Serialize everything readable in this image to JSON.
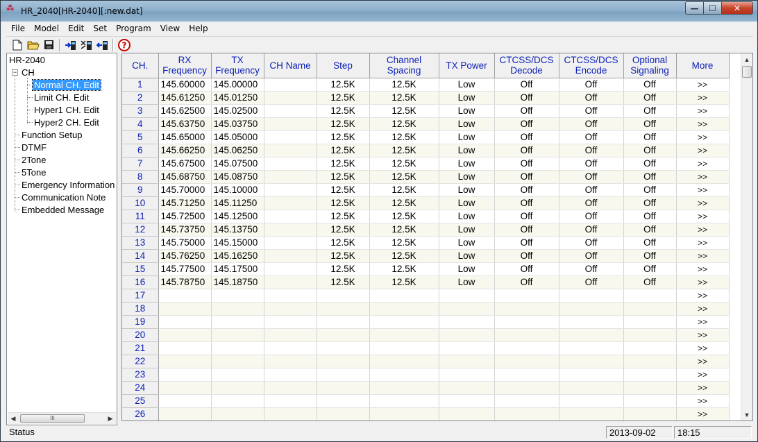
{
  "window": {
    "title": "HR_2040[HR-2040][:new.dat]",
    "controls": {
      "minimize": "—",
      "maximize": "☐",
      "close": "✕"
    }
  },
  "menu": [
    "File",
    "Model",
    "Edit",
    "Set",
    "Program",
    "View",
    "Help"
  ],
  "toolbar": {
    "buttons": [
      "new-file-icon",
      "open-folder-icon",
      "save-icon",
      "read-radio-icon",
      "write-radio-icon",
      "clone-radio-icon",
      "help-icon"
    ]
  },
  "tree": {
    "root": "HR-2040",
    "ch": "CH",
    "ch_children": [
      "Normal CH. Edit",
      "Limit CH. Edit",
      "Hyper1 CH. Edit",
      "Hyper2 CH. Edit"
    ],
    "items": [
      "Function Setup",
      "DTMF",
      "2Tone",
      "5Tone",
      "Emergency Information",
      "Communication Note",
      "Embedded Message"
    ],
    "selected": "Normal CH. Edit",
    "hscroll_thumb": "III"
  },
  "grid": {
    "columns": [
      {
        "line1": "CH.",
        "line2": ""
      },
      {
        "line1": "RX",
        "line2": "Frequency"
      },
      {
        "line1": "TX",
        "line2": "Frequency"
      },
      {
        "line1": "CH Name",
        "line2": ""
      },
      {
        "line1": "Step",
        "line2": ""
      },
      {
        "line1": "Channel",
        "line2": "Spacing"
      },
      {
        "line1": "TX Power",
        "line2": ""
      },
      {
        "line1": "CTCSS/DCS",
        "line2": "Decode"
      },
      {
        "line1": "CTCSS/DCS",
        "line2": "Encode"
      },
      {
        "line1": "Optional",
        "line2": "Signaling"
      },
      {
        "line1": "More",
        "line2": ""
      }
    ],
    "rows": [
      {
        "ch": "1",
        "rx": "145.60000",
        "tx": "145.00000",
        "name": "",
        "step": "12.5K",
        "spacing": "12.5K",
        "power": "Low",
        "decode": "Off",
        "encode": "Off",
        "signaling": "Off",
        "more": ">>"
      },
      {
        "ch": "2",
        "rx": "145.61250",
        "tx": "145.01250",
        "name": "",
        "step": "12.5K",
        "spacing": "12.5K",
        "power": "Low",
        "decode": "Off",
        "encode": "Off",
        "signaling": "Off",
        "more": ">>"
      },
      {
        "ch": "3",
        "rx": "145.62500",
        "tx": "145.02500",
        "name": "",
        "step": "12.5K",
        "spacing": "12.5K",
        "power": "Low",
        "decode": "Off",
        "encode": "Off",
        "signaling": "Off",
        "more": ">>"
      },
      {
        "ch": "4",
        "rx": "145.63750",
        "tx": "145.03750",
        "name": "",
        "step": "12.5K",
        "spacing": "12.5K",
        "power": "Low",
        "decode": "Off",
        "encode": "Off",
        "signaling": "Off",
        "more": ">>"
      },
      {
        "ch": "5",
        "rx": "145.65000",
        "tx": "145.05000",
        "name": "",
        "step": "12.5K",
        "spacing": "12.5K",
        "power": "Low",
        "decode": "Off",
        "encode": "Off",
        "signaling": "Off",
        "more": ">>"
      },
      {
        "ch": "6",
        "rx": "145.66250",
        "tx": "145.06250",
        "name": "",
        "step": "12.5K",
        "spacing": "12.5K",
        "power": "Low",
        "decode": "Off",
        "encode": "Off",
        "signaling": "Off",
        "more": ">>"
      },
      {
        "ch": "7",
        "rx": "145.67500",
        "tx": "145.07500",
        "name": "",
        "step": "12.5K",
        "spacing": "12.5K",
        "power": "Low",
        "decode": "Off",
        "encode": "Off",
        "signaling": "Off",
        "more": ">>"
      },
      {
        "ch": "8",
        "rx": "145.68750",
        "tx": "145.08750",
        "name": "",
        "step": "12.5K",
        "spacing": "12.5K",
        "power": "Low",
        "decode": "Off",
        "encode": "Off",
        "signaling": "Off",
        "more": ">>"
      },
      {
        "ch": "9",
        "rx": "145.70000",
        "tx": "145.10000",
        "name": "",
        "step": "12.5K",
        "spacing": "12.5K",
        "power": "Low",
        "decode": "Off",
        "encode": "Off",
        "signaling": "Off",
        "more": ">>"
      },
      {
        "ch": "10",
        "rx": "145.71250",
        "tx": "145.11250",
        "name": "",
        "step": "12.5K",
        "spacing": "12.5K",
        "power": "Low",
        "decode": "Off",
        "encode": "Off",
        "signaling": "Off",
        "more": ">>"
      },
      {
        "ch": "11",
        "rx": "145.72500",
        "tx": "145.12500",
        "name": "",
        "step": "12.5K",
        "spacing": "12.5K",
        "power": "Low",
        "decode": "Off",
        "encode": "Off",
        "signaling": "Off",
        "more": ">>"
      },
      {
        "ch": "12",
        "rx": "145.73750",
        "tx": "145.13750",
        "name": "",
        "step": "12.5K",
        "spacing": "12.5K",
        "power": "Low",
        "decode": "Off",
        "encode": "Off",
        "signaling": "Off",
        "more": ">>"
      },
      {
        "ch": "13",
        "rx": "145.75000",
        "tx": "145.15000",
        "name": "",
        "step": "12.5K",
        "spacing": "12.5K",
        "power": "Low",
        "decode": "Off",
        "encode": "Off",
        "signaling": "Off",
        "more": ">>"
      },
      {
        "ch": "14",
        "rx": "145.76250",
        "tx": "145.16250",
        "name": "",
        "step": "12.5K",
        "spacing": "12.5K",
        "power": "Low",
        "decode": "Off",
        "encode": "Off",
        "signaling": "Off",
        "more": ">>"
      },
      {
        "ch": "15",
        "rx": "145.77500",
        "tx": "145.17500",
        "name": "",
        "step": "12.5K",
        "spacing": "12.5K",
        "power": "Low",
        "decode": "Off",
        "encode": "Off",
        "signaling": "Off",
        "more": ">>"
      },
      {
        "ch": "16",
        "rx": "145.78750",
        "tx": "145.18750",
        "name": "",
        "step": "12.5K",
        "spacing": "12.5K",
        "power": "Low",
        "decode": "Off",
        "encode": "Off",
        "signaling": "Off",
        "more": ">>"
      },
      {
        "ch": "17",
        "rx": "",
        "tx": "",
        "name": "",
        "step": "",
        "spacing": "",
        "power": "",
        "decode": "",
        "encode": "",
        "signaling": "",
        "more": ">>"
      },
      {
        "ch": "18",
        "rx": "",
        "tx": "",
        "name": "",
        "step": "",
        "spacing": "",
        "power": "",
        "decode": "",
        "encode": "",
        "signaling": "",
        "more": ">>"
      },
      {
        "ch": "19",
        "rx": "",
        "tx": "",
        "name": "",
        "step": "",
        "spacing": "",
        "power": "",
        "decode": "",
        "encode": "",
        "signaling": "",
        "more": ">>"
      },
      {
        "ch": "20",
        "rx": "",
        "tx": "",
        "name": "",
        "step": "",
        "spacing": "",
        "power": "",
        "decode": "",
        "encode": "",
        "signaling": "",
        "more": ">>"
      },
      {
        "ch": "21",
        "rx": "",
        "tx": "",
        "name": "",
        "step": "",
        "spacing": "",
        "power": "",
        "decode": "",
        "encode": "",
        "signaling": "",
        "more": ">>"
      },
      {
        "ch": "22",
        "rx": "",
        "tx": "",
        "name": "",
        "step": "",
        "spacing": "",
        "power": "",
        "decode": "",
        "encode": "",
        "signaling": "",
        "more": ">>"
      },
      {
        "ch": "23",
        "rx": "",
        "tx": "",
        "name": "",
        "step": "",
        "spacing": "",
        "power": "",
        "decode": "",
        "encode": "",
        "signaling": "",
        "more": ">>"
      },
      {
        "ch": "24",
        "rx": "",
        "tx": "",
        "name": "",
        "step": "",
        "spacing": "",
        "power": "",
        "decode": "",
        "encode": "",
        "signaling": "",
        "more": ">>"
      },
      {
        "ch": "25",
        "rx": "",
        "tx": "",
        "name": "",
        "step": "",
        "spacing": "",
        "power": "",
        "decode": "",
        "encode": "",
        "signaling": "",
        "more": ">>"
      },
      {
        "ch": "26",
        "rx": "",
        "tx": "",
        "name": "",
        "step": "",
        "spacing": "",
        "power": "",
        "decode": "",
        "encode": "",
        "signaling": "",
        "more": ">>"
      }
    ]
  },
  "status": {
    "text": "Status",
    "date": "2013-09-02",
    "time": "18:15"
  },
  "colors": {
    "header_text": "#0b1fb5",
    "selection": "#3399ff",
    "alt_row": "#f8f8ee"
  }
}
